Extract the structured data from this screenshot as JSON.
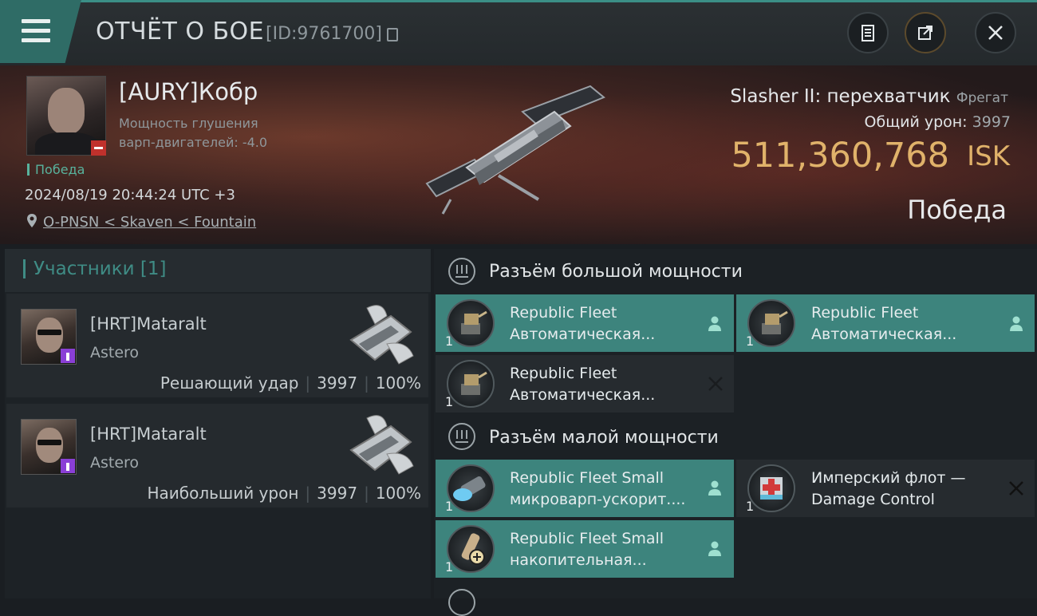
{
  "header": {
    "title": "ОТЧЁТ О БОЕ",
    "report_id": "[ID:9761700]"
  },
  "victim": {
    "name": "[AURY]Кобр",
    "attribute_line1": "Мощность глушения",
    "attribute_line2": "варп-двигателей: -4.0",
    "result_tag": "Победа",
    "datetime": "2024/08/19 20:44:24 UTC +3",
    "location": "O-PNSN < Skaven < Fountain",
    "ship_name": "Slasher II: перехватчик",
    "ship_class": "Фрегат",
    "damage_label": "Общий урон:",
    "damage_value": "3997",
    "isk_value": "511,360,768",
    "isk_unit": "ISK",
    "outcome": "Победа"
  },
  "participants": {
    "title": "Участники [1]",
    "items": [
      {
        "name": "[HRT]Mataralt",
        "ship": "Astero",
        "role": "Решающий удар",
        "damage": "3997",
        "percent": "100%"
      },
      {
        "name": "[HRT]Mataralt",
        "ship": "Astero",
        "role": "Наибольший урон",
        "damage": "3997",
        "percent": "100%"
      }
    ]
  },
  "fittings": {
    "high_title": "Разъём большой мощности",
    "low_title": "Разъём малой мощности",
    "high": [
      {
        "qty": "1",
        "line1": "Republic Fleet",
        "line2": "Автоматическая...",
        "state": "dropped",
        "icon": "autocannon-icon"
      },
      {
        "qty": "1",
        "line1": "Republic Fleet",
        "line2": "Автоматическая...",
        "state": "dropped",
        "icon": "autocannon-icon"
      },
      {
        "qty": "1",
        "line1": "Republic Fleet",
        "line2": "Автоматическая...",
        "state": "destroyed",
        "icon": "autocannon-icon"
      }
    ],
    "low": [
      {
        "qty": "1",
        "line1": "Republic Fleet Small",
        "line2": "микроварп-ускорит....",
        "state": "dropped",
        "icon": "microwarpdrive-icon"
      },
      {
        "qty": "1",
        "line1": "Имперский флот —",
        "line2": "Damage Control",
        "state": "destroyed",
        "icon": "damage-control-icon"
      },
      {
        "qty": "1",
        "line1": "Republic Fleet Small",
        "line2": "накопительная...",
        "state": "dropped",
        "icon": "capacitor-battery-icon"
      }
    ]
  },
  "colors": {
    "accent": "#3f8c85",
    "dropped_bg": "#3d847d",
    "destroyed_bg": "#262b2f",
    "isk": "#e0b26a",
    "victory": "#58b39d"
  }
}
